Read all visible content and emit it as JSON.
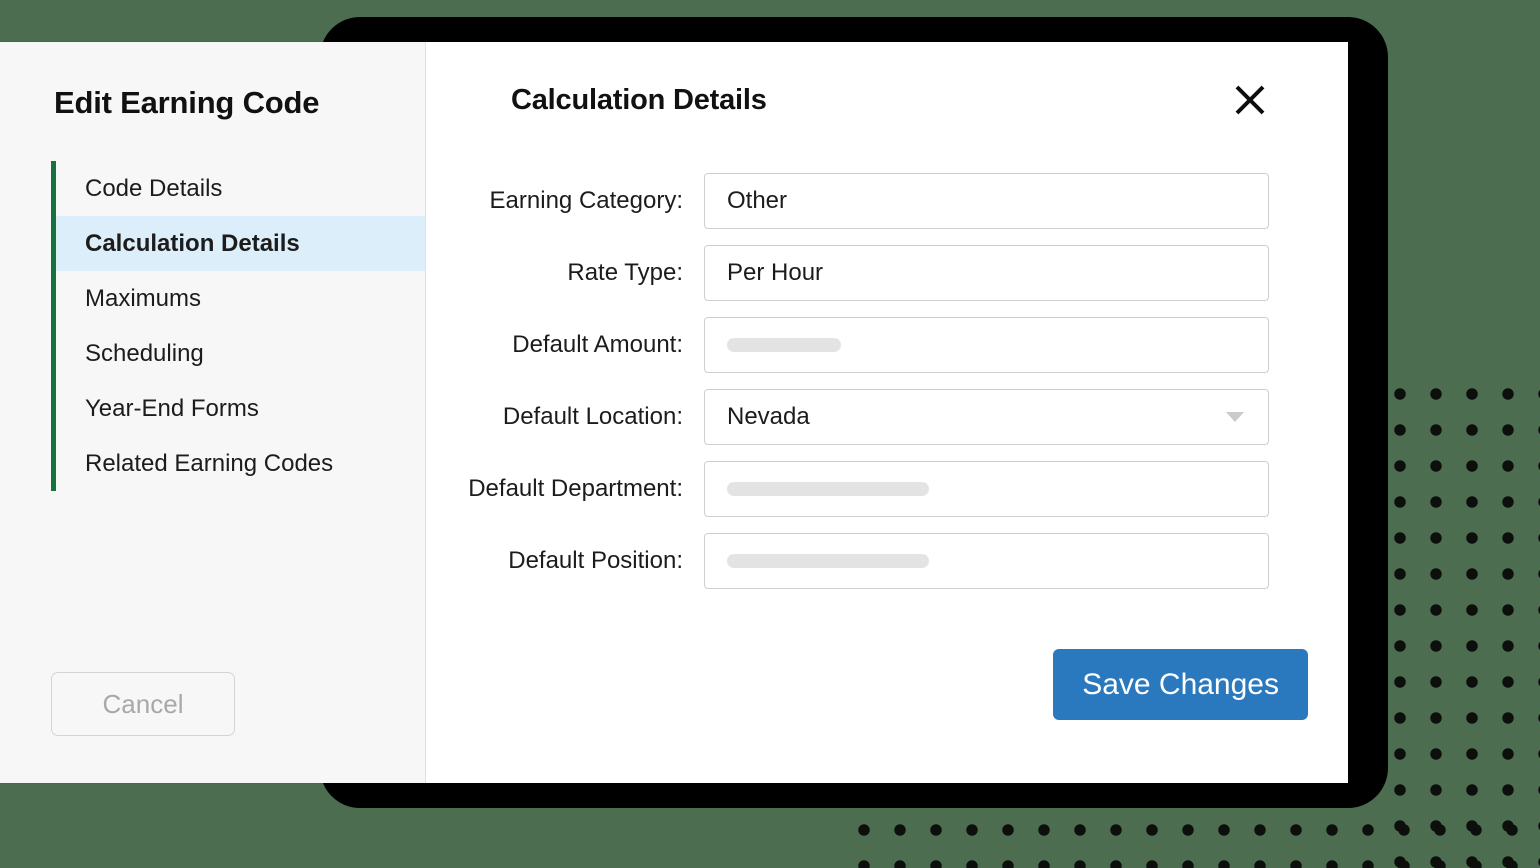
{
  "theme": {
    "page_background": "#4d6d50",
    "backing_card": "#000000",
    "accent_green": "#15723f",
    "active_item_background": "#ddeefb",
    "primary_button": "#2a78bd",
    "sidebar_background": "#f7f7f7"
  },
  "sidebar": {
    "title": "Edit Earning Code",
    "items": [
      {
        "label": "Code Details",
        "active": false
      },
      {
        "label": "Calculation Details",
        "active": true
      },
      {
        "label": "Maximums",
        "active": false
      },
      {
        "label": "Scheduling",
        "active": false
      },
      {
        "label": "Year-End Forms",
        "active": false
      },
      {
        "label": "Related Earning Codes",
        "active": false
      }
    ],
    "cancel_label": "Cancel"
  },
  "main": {
    "title": "Calculation Details",
    "close_icon": "close-icon",
    "fields": [
      {
        "label": "Earning Category:",
        "value": "Other",
        "type": "text",
        "placeholder_style": "none"
      },
      {
        "label": "Rate Type:",
        "value": "Per Hour",
        "type": "text",
        "placeholder_style": "none"
      },
      {
        "label": "Default Amount:",
        "value": "",
        "type": "text",
        "placeholder_style": "skeleton-short"
      },
      {
        "label": "Default Location:",
        "value": "Nevada",
        "type": "select",
        "placeholder_style": "none"
      },
      {
        "label": "Default Department:",
        "value": "",
        "type": "text",
        "placeholder_style": "skeleton-long"
      },
      {
        "label": "Default Position:",
        "value": "",
        "type": "text",
        "placeholder_style": "skeleton-long"
      }
    ],
    "save_label": "Save Changes"
  }
}
